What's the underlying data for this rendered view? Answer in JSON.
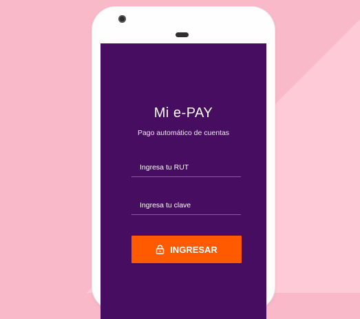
{
  "app": {
    "title": "Mi  e-PAY",
    "subtitle": "Pago automático de cuentas"
  },
  "form": {
    "rut_placeholder": "Ingresa tu RUT",
    "password_placeholder": "Ingresa tu clave",
    "submit_label": "INGRESAR",
    "submit_icon": "lock-icon"
  },
  "colors": {
    "background": "#f9b9c9",
    "screen": "#470d61",
    "accent": "#ff5a00"
  }
}
